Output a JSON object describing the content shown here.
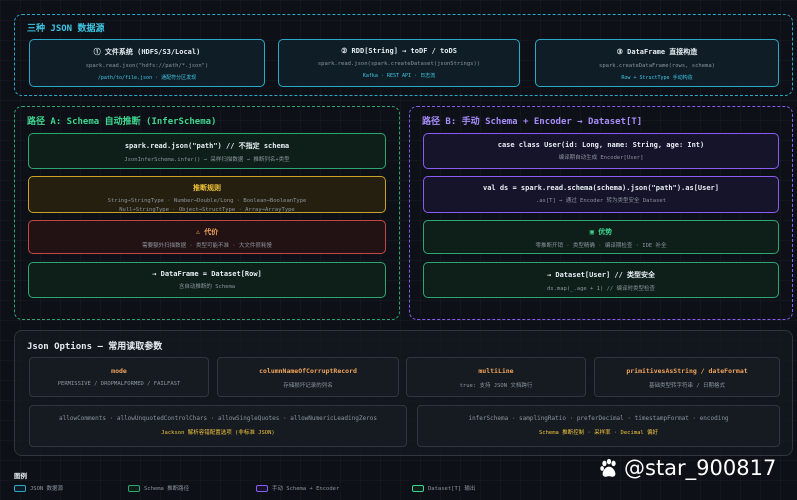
{
  "sources": {
    "title": "三种 JSON 数据源",
    "cards": [
      {
        "title": "① 文件系统 (HDFS/S3/Local)",
        "code": "spark.read.json(\"hdfs://path/*.json\")",
        "note": "/path/to/file.json · 通配符分区发现"
      },
      {
        "title": "② RDD[String] → toDF / toDS",
        "code": "spark.read.json(spark.createDataset(jsonStrings))",
        "note": "Kafka · REST API · 日志流"
      },
      {
        "title": "③ DataFrame 直接构造",
        "code": "spark.createDataFrame(rows, schema)",
        "note": "Row + StructType 手动构造"
      }
    ]
  },
  "path_a": {
    "title": "路径 A: Schema 自动推断 (InferSchema)",
    "read": {
      "title": "spark.read.json(\"path\") // 不指定 schema",
      "desc": "JsonInferSchema.infer() → 采样扫描数据 → 推断列名+类型"
    },
    "rules": {
      "title": "推断规则",
      "line1": "String→StringType · Number→Double/Long · Boolean→BooleanType",
      "line2": "Null→StringType · Object→StructType · Array→ArrayType"
    },
    "cost": {
      "title": "⚠ 代价",
      "desc": "需要额外扫描数据 · 类型可能不准 · 大文件很耗慢"
    },
    "result": {
      "title": "→ DataFrame = Dataset[Row]",
      "desc": "含自动推断的 Schema"
    }
  },
  "path_b": {
    "title": "路径 B: 手动 Schema + Encoder → Dataset[T]",
    "case_class": {
      "title": "case class User(id: Long, name: String, age: Int)",
      "desc": "编译期自动生成 Encoder[User]"
    },
    "read": {
      "title": "val ds = spark.read.schema(schema).json(\"path\").as[User]",
      "desc": ".as[T] → 通过 Encoder 转为类型安全 Dataset"
    },
    "advantage": {
      "title": "▣ 优势",
      "desc": "零推断开销 · 类型精确 · 编译期检查 · IDE 补全"
    },
    "result": {
      "title": "→ Dataset[User] // 类型安全",
      "desc": "ds.map(_.age + 1) // 编译时类型检查"
    }
  },
  "options": {
    "title": "Json Options — 常用读取参数",
    "cards": [
      {
        "title": "mode",
        "desc": "PERMISSIVE / DROPMALFORMED / FAILFAST"
      },
      {
        "title": "columnNameOfCorruptRecord",
        "desc": "存储损坏记录的列名"
      },
      {
        "title": "multiLine",
        "desc": "true: 支持 JSON 文档跨行"
      },
      {
        "title": "primitivesAsString / dateFormat",
        "desc": "基础类型转字符串 / 日期格式"
      }
    ],
    "wide": [
      {
        "title": "allowComments · allowUnquotedControlChars · allowSingleQuotes · allowNumericLeadingZeros",
        "desc": "Jackson 解析容错配置选项 (非标准 JSON)"
      },
      {
        "title": "inferSchema · samplingRatio · preferDecimal · timestampFormat · encoding",
        "desc": "Schema 推断控制 · 采样率 · Decimal 偏好"
      }
    ]
  },
  "legend": {
    "title": "图例",
    "items": [
      {
        "label": "JSON 数据源",
        "color": "#2ba9c9"
      },
      {
        "label": "Schema 推断路径",
        "color": "#2ea672"
      },
      {
        "label": "手动 Schema + Encoder",
        "color": "#8a5cf6"
      },
      {
        "label": "Dataset[T] 输出",
        "color": "#3fd68f"
      }
    ]
  },
  "watermark": {
    "text": "@star_900817"
  }
}
